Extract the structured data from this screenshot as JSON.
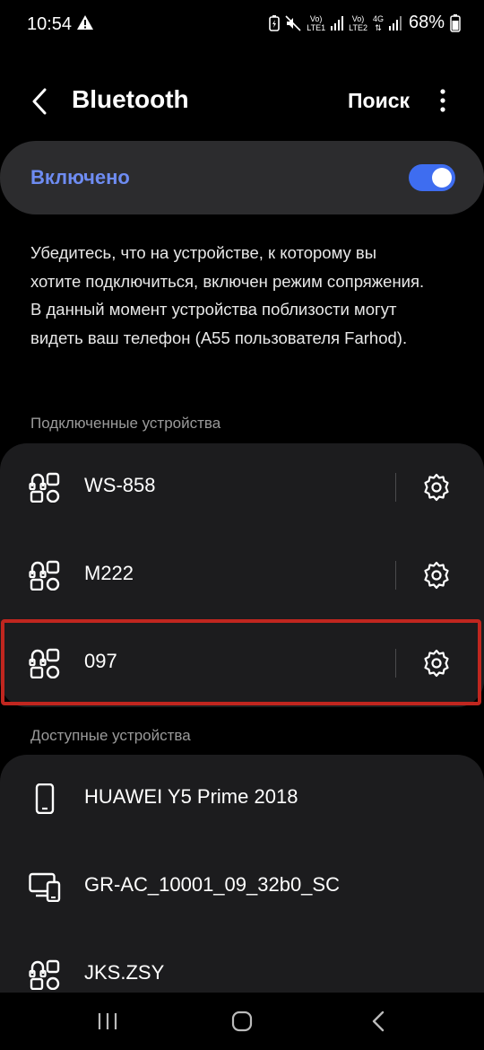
{
  "status_bar": {
    "time": "10:54",
    "lte1": "LTE1",
    "vol1": "Vo)",
    "lte2": "LTE2",
    "vol2": "Vo)",
    "net": "4G",
    "battery": "68%"
  },
  "header": {
    "title": "Bluetooth",
    "search_label": "Поиск"
  },
  "toggle": {
    "label": "Включено",
    "state": "on"
  },
  "description": "Убедитесь, что на устройстве, к которому вы хотите подключиться, включен режим сопряжения. В данный момент устройства поблизости могут видеть ваш телефон (A55 пользователя Farhod).",
  "connected": {
    "title": "Подключенные устройства",
    "devices": [
      {
        "name": "WS-858",
        "icon": "device-generic-icon"
      },
      {
        "name": "M222",
        "icon": "device-generic-icon"
      },
      {
        "name": "097",
        "icon": "device-generic-icon"
      }
    ]
  },
  "available": {
    "title": "Доступные устройства",
    "devices": [
      {
        "name": "HUAWEI Y5 Prime 2018",
        "icon": "phone-icon"
      },
      {
        "name": "GR-AC_10001_09_32b0_SC",
        "icon": "computer-icon"
      },
      {
        "name": "JKS.ZSY",
        "icon": "device-generic-icon"
      }
    ]
  },
  "colors": {
    "accent": "#6e8cf2",
    "switch": "#3e6df0",
    "highlight": "#c0261f"
  }
}
